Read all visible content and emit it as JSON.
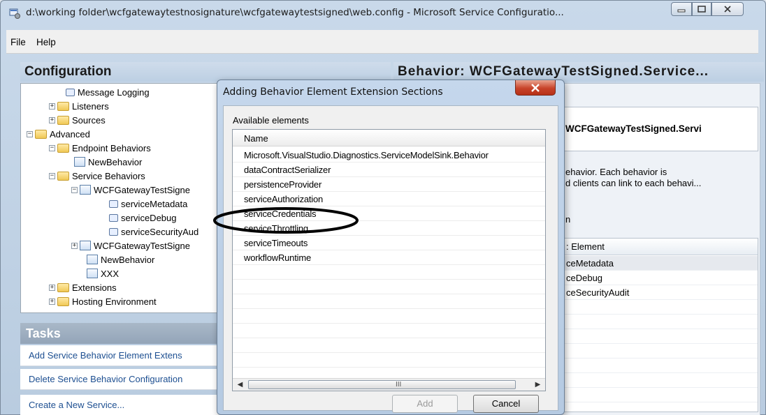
{
  "window": {
    "title": "d:\\working folder\\wcfgatewaytestnosignature\\wcfgatewaytestsigned\\web.config - Microsoft Service Configuratio..."
  },
  "menu": {
    "file": "File",
    "help": "Help"
  },
  "left": {
    "header": "Configuration",
    "tree": [
      "Message Logging",
      "Listeners",
      "Sources",
      "Advanced",
      "Endpoint Behaviors",
      "NewBehavior",
      "Service Behaviors",
      "WCFGatewayTestSigne",
      "serviceMetadata",
      "serviceDebug",
      "serviceSecurityAud",
      "WCFGatewayTestSigne",
      "NewBehavior",
      "XXX",
      "Extensions",
      "Hosting Environment"
    ],
    "tasks_header": "Tasks",
    "tasks": [
      "Add Service Behavior Element Extens",
      "Delete Service Behavior Configuration",
      "Create a New Service..."
    ]
  },
  "right": {
    "header": "Behavior:  WCFGatewayTestSigned.Service...",
    "name_value": "WCFGatewayTestSigned.Servi",
    "desc_line1": "ehavior. Each behavior is",
    "desc_line2": "d clients can link to each behavi...",
    "section_label": "n",
    "grid_header": ": Element",
    "grid_rows": [
      "ceMetadata",
      "ceDebug",
      "ceSecurityAudit"
    ]
  },
  "dialog": {
    "title": "Adding Behavior Element Extension Sections",
    "available_label": "Available elements",
    "column_name": "Name",
    "items": [
      "Microsoft.VisualStudio.Diagnostics.ServiceModelSink.Behavior",
      "dataContractSerializer",
      "persistenceProvider",
      "serviceAuthorization",
      "serviceCredentials",
      "serviceThrottling",
      "serviceTimeouts",
      "workflowRuntime"
    ],
    "scroll_grip": "III",
    "add_label": "Add",
    "cancel_label": "Cancel"
  }
}
